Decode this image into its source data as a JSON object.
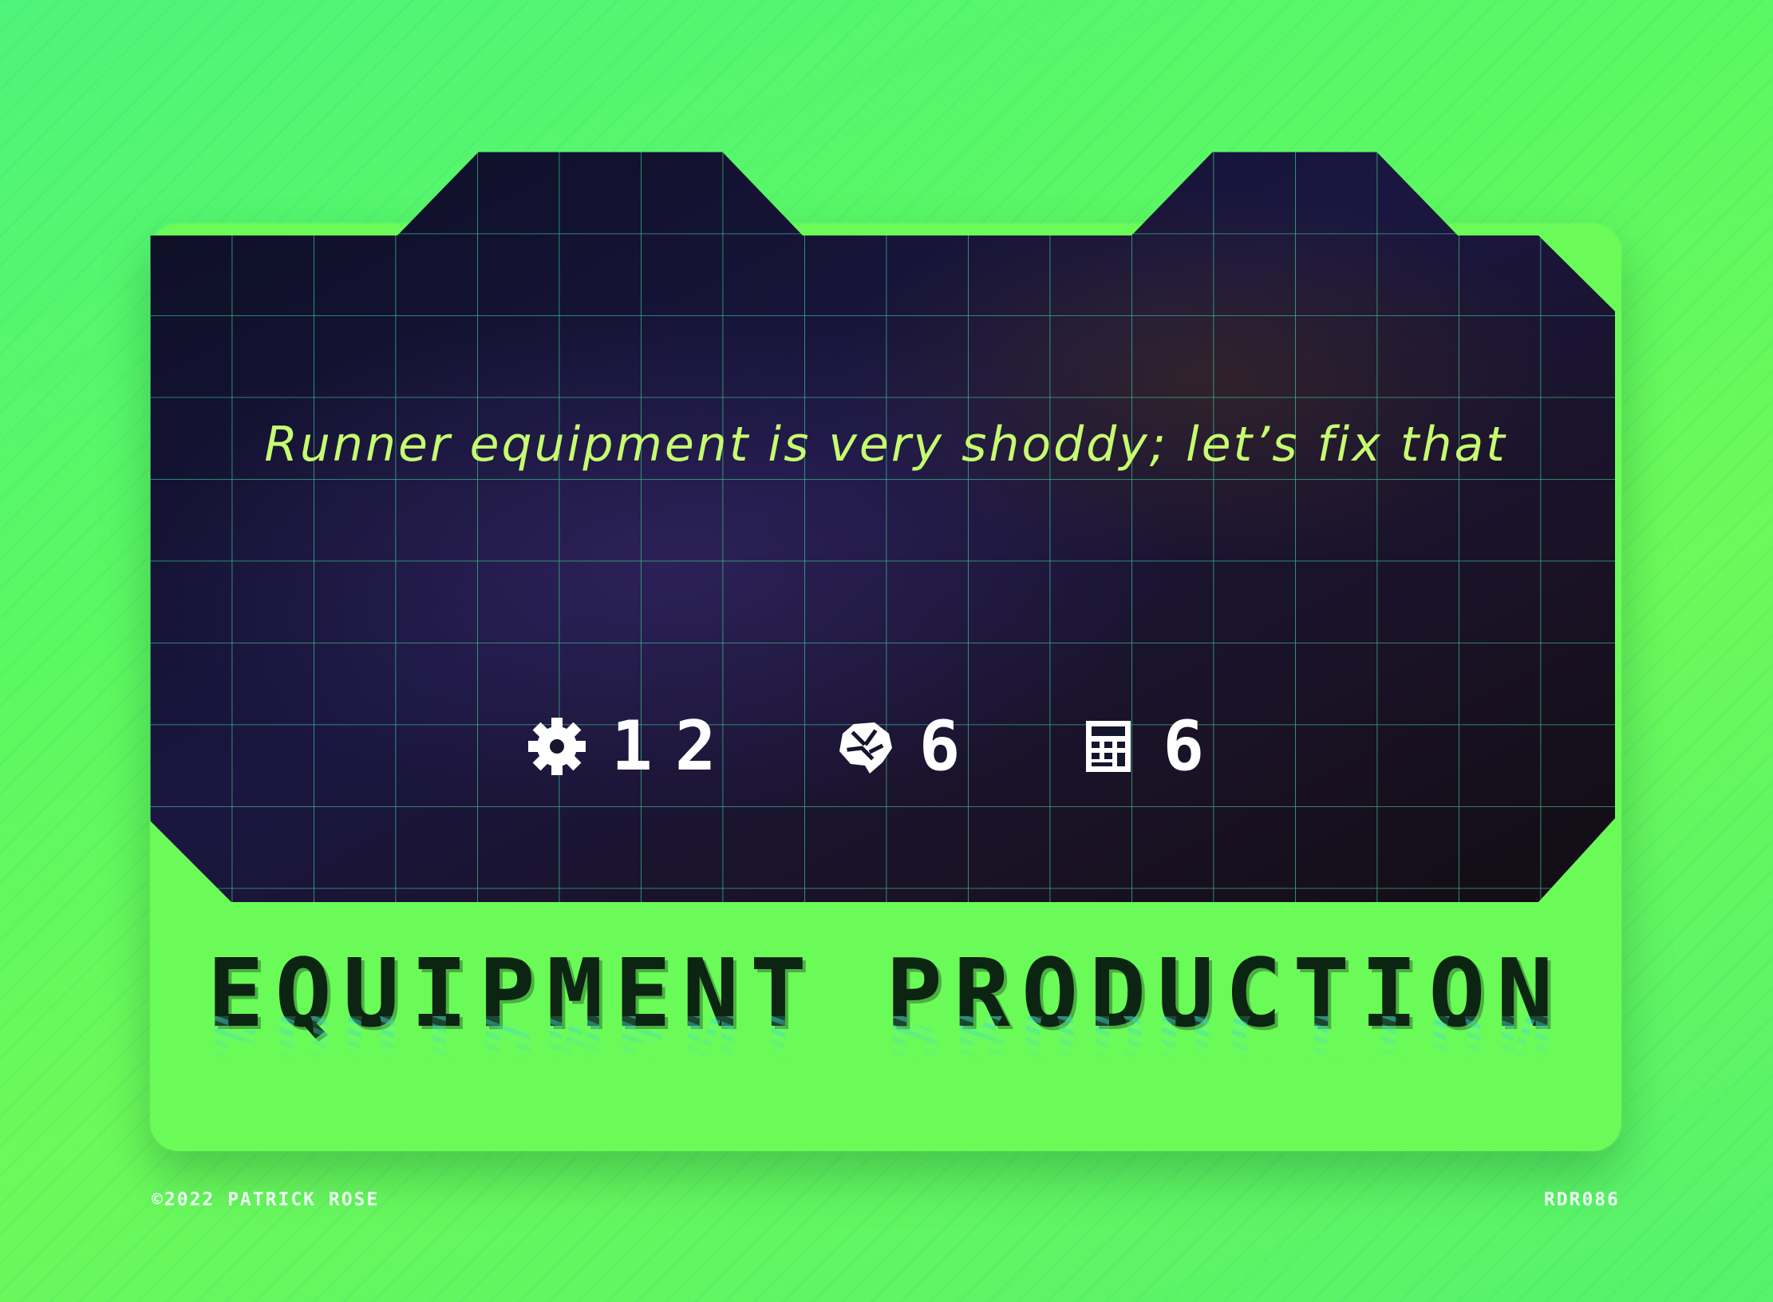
{
  "card": {
    "flavor_text": "Runner equipment is very shoddy; let’s fix that",
    "costs": [
      {
        "icon": "gear-icon",
        "value": "12"
      },
      {
        "icon": "brain-icon",
        "value": "6"
      },
      {
        "icon": "calculator-icon",
        "value": "6"
      }
    ],
    "title": "EQUIPMENT PRODUCTION"
  },
  "footer": {
    "copyright": "©2022 PATRICK ROSE",
    "card_code": "RDR086"
  },
  "colors": {
    "background": "#5cf862",
    "screen": "#12122a",
    "grid": "#3fe09a",
    "flavor_text": "#c6fb70",
    "title": "#0c2412"
  }
}
